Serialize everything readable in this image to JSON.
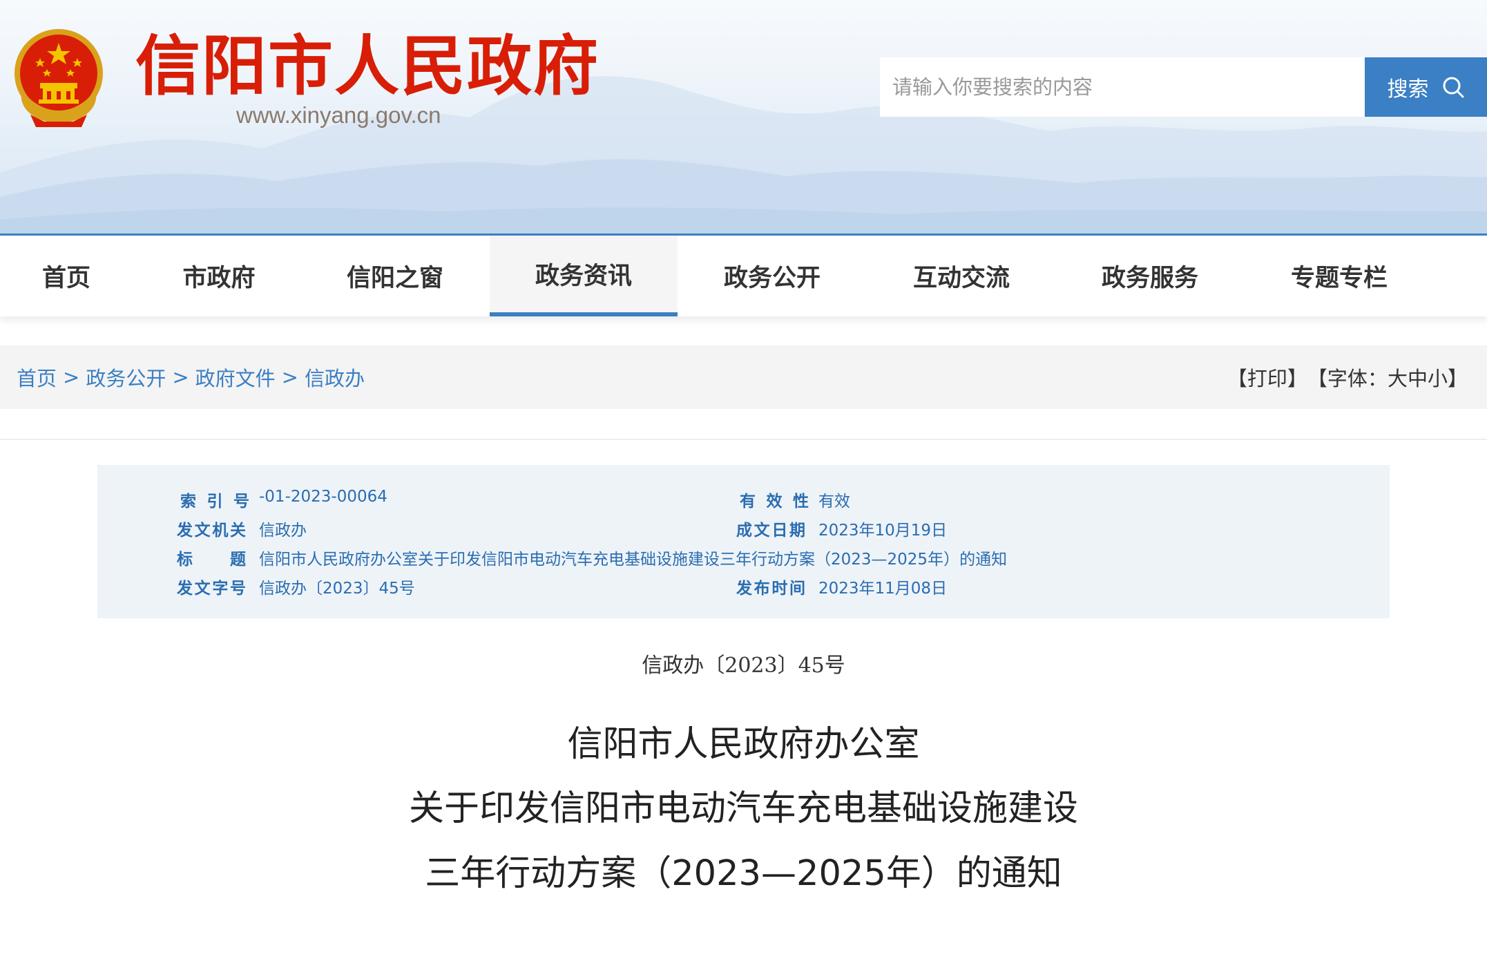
{
  "header": {
    "site_title": "信阳市人民政府",
    "site_url": "www.xinyang.gov.cn",
    "search": {
      "placeholder": "请输入你要搜索的内容",
      "button_label": "搜索"
    }
  },
  "nav": {
    "items": [
      {
        "label": "首页"
      },
      {
        "label": "市政府"
      },
      {
        "label": "信阳之窗"
      },
      {
        "label": "政务资讯"
      },
      {
        "label": "政务公开"
      },
      {
        "label": "互动交流"
      },
      {
        "label": "政务服务"
      },
      {
        "label": "专题专栏"
      }
    ],
    "active_item": "政务资讯"
  },
  "breadcrumb": {
    "items": [
      "首页",
      "政务公开",
      "政府文件",
      "信政办"
    ],
    "separator": ">"
  },
  "tools": {
    "print_label": "【打印】",
    "font_prefix": "【字体：",
    "font_large": "大",
    "font_medium": "中",
    "font_small": "小",
    "font_suffix": "】"
  },
  "meta": {
    "index_no": {
      "label": "索引号",
      "value": "-01-2023-00064"
    },
    "issuer": {
      "label": "发文机关",
      "value": "信政办"
    },
    "title": {
      "label": "标题",
      "value": "信阳市人民政府办公室关于印发信阳市电动汽车充电基础设施建设三年行动方案（2023—2025年）的通知"
    },
    "doc_no": {
      "label": "发文字号",
      "value": "信政办〔2023〕45号"
    },
    "validity": {
      "label": "有效性",
      "value": "有效"
    },
    "created_date": {
      "label": "成文日期",
      "value": "2023年10月19日"
    },
    "publish_date": {
      "label": "发布时间",
      "value": "2023年11月08日"
    }
  },
  "document": {
    "number": "信政办〔2023〕45号",
    "title_lines": [
      "信阳市人民政府办公室",
      "关于印发信阳市电动汽车充电基础设施建设",
      "三年行动方案（2023—2025年）的通知"
    ]
  },
  "colors": {
    "brand_red": "#d81e06",
    "accent_blue": "#3b7fc4",
    "meta_text": "#2a6db0",
    "meta_bg": "#eef3f8"
  },
  "icons": {
    "emblem": "national-emblem-icon",
    "search": "search-icon"
  }
}
